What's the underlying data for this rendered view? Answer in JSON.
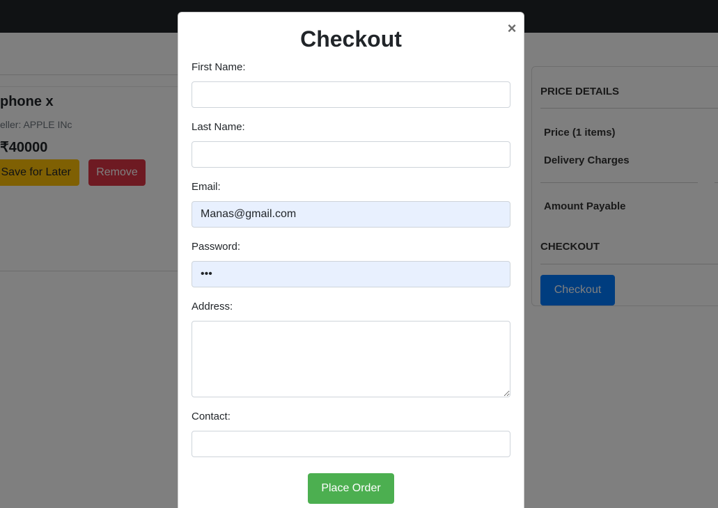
{
  "background": {
    "cart": {
      "product_name": "phone x",
      "seller": "eller: APPLE INc",
      "price": "₹40000",
      "save_later_label": "Save for Later",
      "remove_label": "Remove"
    },
    "price_details": {
      "title": "PRICE DETAILS",
      "price_label": "Price (1 items)",
      "delivery_label": "Delivery Charges",
      "amount_label": "Amount Payable",
      "checkout_title": "CHECKOUT",
      "checkout_button": "Checkout"
    }
  },
  "modal": {
    "title": "Checkout",
    "close_glyph": "×",
    "fields": {
      "first_name": {
        "label": "First Name:",
        "value": ""
      },
      "last_name": {
        "label": "Last Name:",
        "value": ""
      },
      "email": {
        "label": "Email:",
        "value": "Manas@gmail.com"
      },
      "password": {
        "label": "Password:",
        "value": "•••"
      },
      "address": {
        "label": "Address:",
        "value": ""
      },
      "contact": {
        "label": "Contact:",
        "value": ""
      }
    },
    "place_order_label": "Place Order"
  },
  "colors": {
    "topbar": "#212529",
    "save_button": "#ffc107",
    "remove_button": "#dc3545",
    "checkout_button": "#007bff",
    "place_order_button": "#4caf50",
    "autofill_bg": "#e8f0fe"
  }
}
